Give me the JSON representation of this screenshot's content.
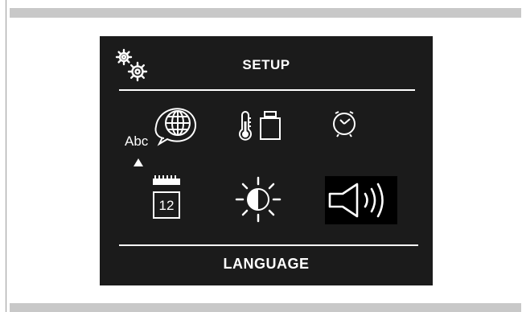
{
  "screen": {
    "title": "SETUP",
    "status_text": "LANGUAGE"
  },
  "menu": {
    "items": [
      {
        "id": "language",
        "icon": "globe-speech-icon",
        "label": "Abc"
      },
      {
        "id": "units",
        "icon": "thermometer-weight-icon"
      },
      {
        "id": "time",
        "icon": "clock-icon"
      },
      {
        "id": "date",
        "icon": "calendar-icon",
        "label": "12"
      },
      {
        "id": "brightness",
        "icon": "brightness-icon"
      },
      {
        "id": "sound",
        "icon": "speaker-icon"
      }
    ],
    "highlighted_item": "sound",
    "cursor_on_item": "language"
  },
  "colors": {
    "screen_bg": "#1b1b1b",
    "foreground": "#ffffff",
    "band": "#c8c8c8",
    "selected_bg": "#000000"
  }
}
